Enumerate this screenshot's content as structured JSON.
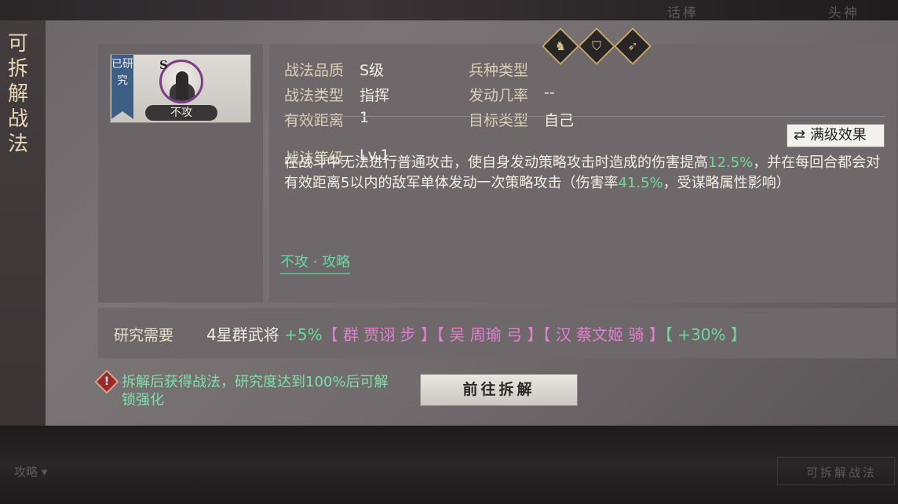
{
  "background": {
    "top_tabs": [
      "话棒",
      "头神"
    ],
    "bottom_left": "攻略 ▾",
    "bottom_right": "可拆解战法"
  },
  "side_title": "可拆解战法",
  "card": {
    "status": "已研究",
    "grade": "S",
    "name": "不攻"
  },
  "attributes": {
    "quality_label": "战法品质",
    "quality_value": "S级",
    "troop_label": "兵种类型",
    "troops": [
      "cavalry-icon",
      "shield-icon",
      "bow-icon"
    ],
    "type_label": "战法类型",
    "type_value": "指挥",
    "rate_label": "发动几率",
    "rate_value": "--",
    "range_label": "有效距离",
    "range_value": "1",
    "target_label": "目标类型",
    "target_value": "自己",
    "level_label": "战法等级",
    "level_value": "Lv.1"
  },
  "max_button": "满级效果",
  "description": {
    "p1": "在战斗中无法进行普通攻击，使自身发动策略攻击时造成的伤害提高",
    "n1": "12.5%",
    "p2": "，并在每回合都会对有效距离5以内的敌军单体发动一次策略攻击（伤害率",
    "n2": "41.5%",
    "p3": "，受谋略属性影响）"
  },
  "tag_link": "不攻 · 攻略",
  "requirement": {
    "label": "研究需要",
    "base": "4星群武将",
    "bonus": "+5%",
    "hero1": "【 群 贾诩 步 】",
    "hero2": "【 吴 周瑜 弓 】",
    "hero3": "【 汉 蔡文姬 骑 】",
    "bonus2": "【 +30% 】"
  },
  "warning": {
    "icon": "!",
    "text": "拆解后获得战法，研究度达到100%后可解锁强化"
  },
  "go_button": "前往拆解",
  "colors": {
    "accent_green": "#6fd69a",
    "hero_purple": "#e07fcf",
    "ribbon_blue": "#3d5f86",
    "warn_red": "#9b2a2a"
  }
}
